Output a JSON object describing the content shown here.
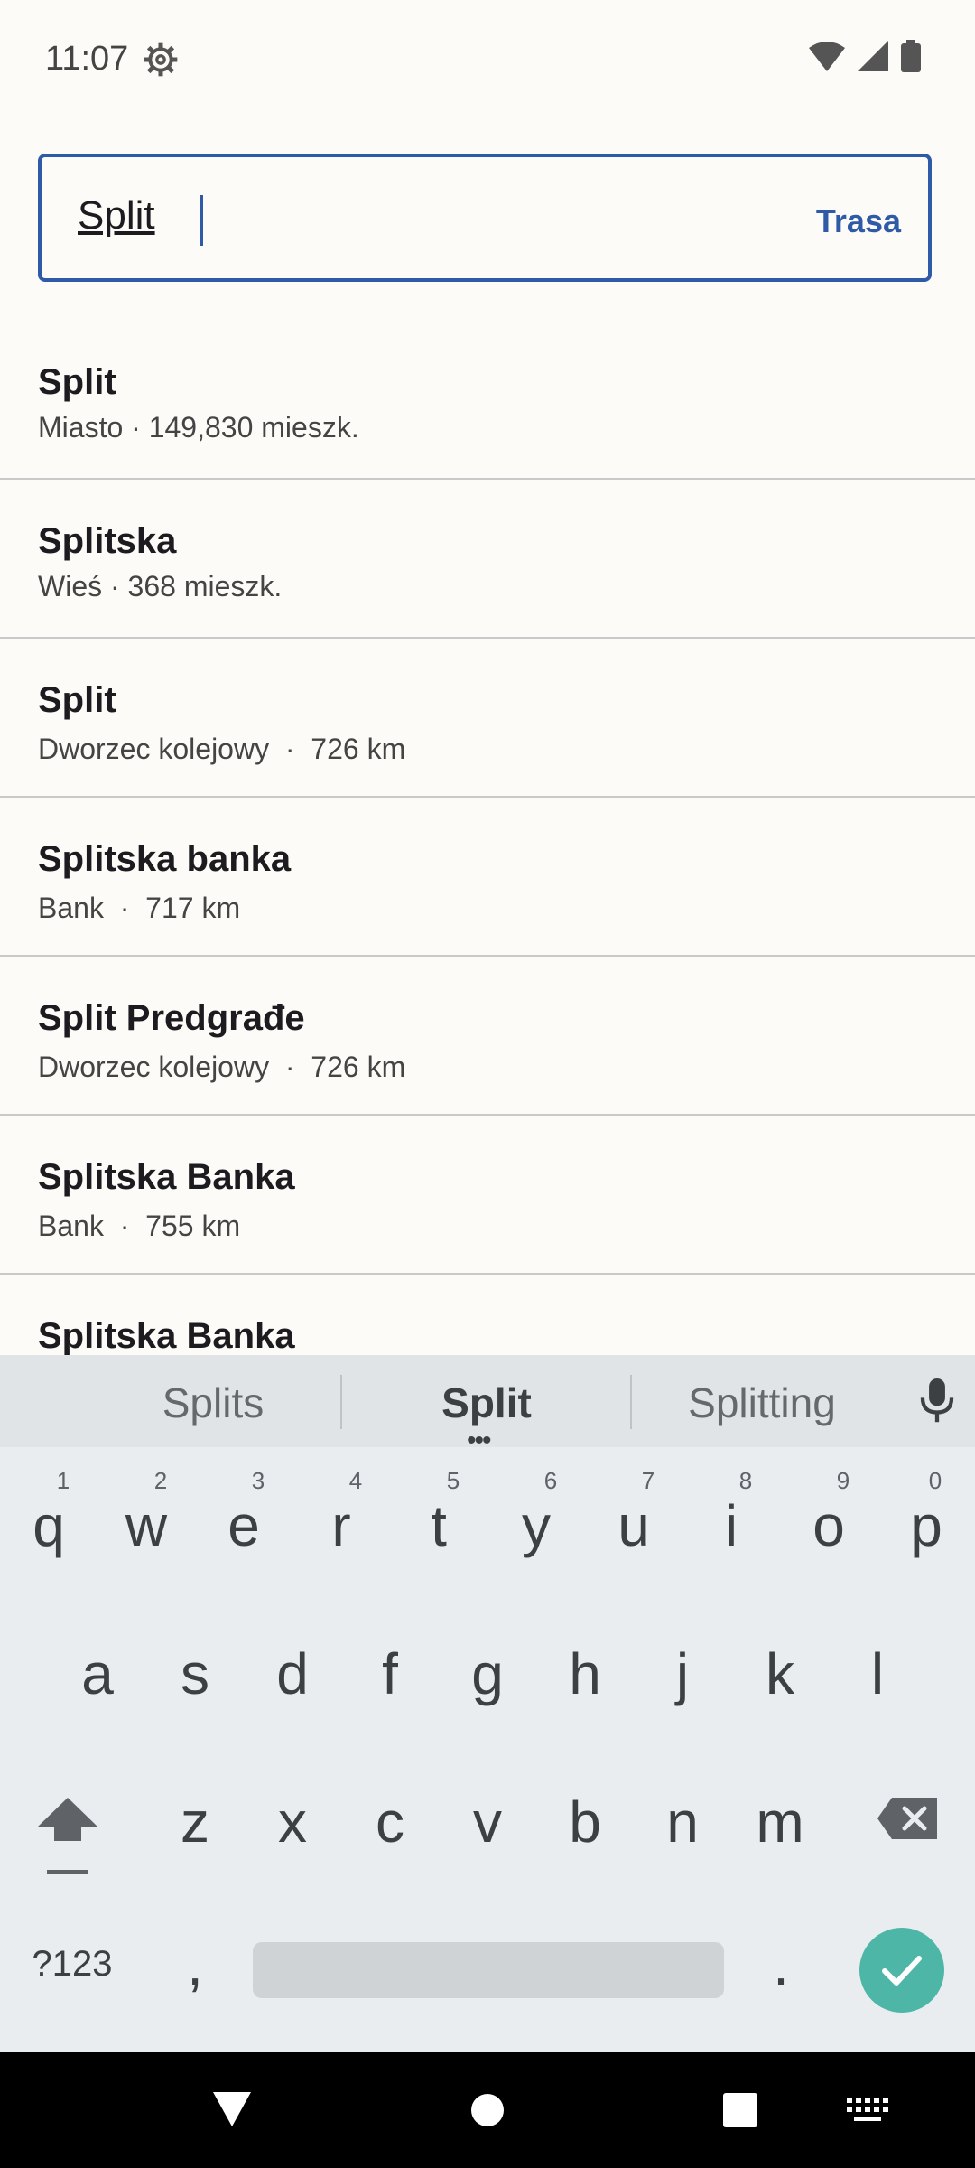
{
  "status": {
    "time": "11:07"
  },
  "search": {
    "value": "Split",
    "route_label": "Trasa"
  },
  "results": [
    {
      "title": "Split",
      "subtitle": "Miasto · 149,830 mieszk."
    },
    {
      "title": "Splitska",
      "subtitle": "Wieś · 368 mieszk."
    },
    {
      "title": "Split",
      "subtitle": "Dworzec kolejowy  ·  726 km"
    },
    {
      "title": "Splitska banka",
      "subtitle": "Bank  ·  717 km"
    },
    {
      "title": "Split Predgrađe",
      "subtitle": "Dworzec kolejowy  ·  726 km"
    },
    {
      "title": "Splitska Banka",
      "subtitle": "Bank  ·  755 km"
    },
    {
      "title": "Splitska Banka",
      "subtitle": ""
    }
  ],
  "keyboard": {
    "suggestions": [
      "Splits",
      "Split",
      "Splitting"
    ],
    "row1": [
      "q",
      "w",
      "e",
      "r",
      "t",
      "y",
      "u",
      "i",
      "o",
      "p"
    ],
    "row1_hints": [
      "1",
      "2",
      "3",
      "4",
      "5",
      "6",
      "7",
      "8",
      "9",
      "0"
    ],
    "row2": [
      "a",
      "s",
      "d",
      "f",
      "g",
      "h",
      "j",
      "k",
      "l"
    ],
    "row3": [
      "z",
      "x",
      "c",
      "v",
      "b",
      "n",
      "m"
    ],
    "symbols_label": "?123",
    "comma": ",",
    "period": "."
  },
  "colors": {
    "accent": "#2f5aa8",
    "enter": "#4db6a7"
  }
}
